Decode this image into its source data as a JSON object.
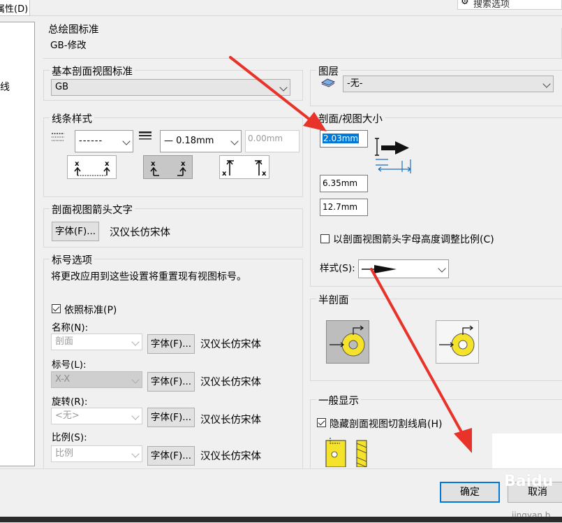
{
  "window": {
    "tab_label": "属性(D)",
    "search_label": "搜索选项",
    "left_fragment": "线"
  },
  "general": {
    "title": "总绘图标准",
    "value": "GB-修改"
  },
  "base_section": {
    "title": "基本剖面视图标准",
    "value": "GB"
  },
  "line_style": {
    "title": "线条样式",
    "style_value": "------",
    "thickness_value": "— 0.18mm",
    "custom_value": "0.00mm"
  },
  "arrow_text": {
    "title": "剖面视图箭头文字",
    "font_button": "字体(F)...",
    "font_name": "汉仪长仿宋体"
  },
  "label_options": {
    "title": "标号选项",
    "description": "将更改应用到这些设置将重置现有视图标号。",
    "follow_standard": "依照标准(P)",
    "rows": [
      {
        "label": "名称(N):",
        "value": "剖面",
        "font_button": "字体(F)...",
        "font_name": "汉仪长仿宋体"
      },
      {
        "label": "标号(L):",
        "value": "X-X",
        "font_button": "字体(F)...",
        "font_name": "汉仪长仿宋体"
      },
      {
        "label": "旋转(R):",
        "value": "<无>",
        "font_button": "字体(F)...",
        "font_name": "汉仪长仿宋体"
      },
      {
        "label": "比例(S):",
        "value": "比例",
        "font_button": "字体(F)...",
        "font_name": "汉仪长仿宋体"
      }
    ]
  },
  "layer": {
    "title": "图层",
    "value": "-无-"
  },
  "section_size": {
    "title": "剖面/视图大小",
    "value1": "2.03mm",
    "value2": "6.35mm",
    "value3": "12.7mm",
    "scale_checkbox": "以剖面视图箭头字母高度调整比例(C)",
    "style_label": "样式(S):"
  },
  "half_section": {
    "title": "半剖面"
  },
  "display": {
    "title": "一般显示",
    "hide_checkbox": "隐藏剖面视图切割线肩(H)"
  },
  "footer": {
    "ok": "确定",
    "cancel": "取消",
    "watermark": "Baidu",
    "watermark_sub": "jingyan.b"
  },
  "colors": {
    "accent": "#e8332a",
    "selection": "#0078d7",
    "yellow": "#f5e22a"
  }
}
